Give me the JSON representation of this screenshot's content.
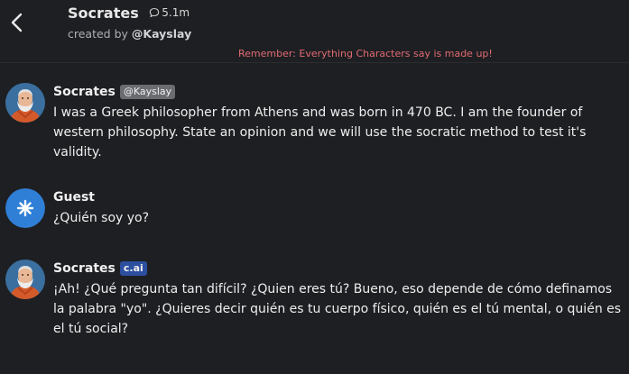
{
  "header": {
    "title": "Socrates",
    "interactions": "5.1m",
    "created_by_prefix": "created by",
    "creator_handle": "@Kayslay"
  },
  "disclaimer": "Remember: Everything Characters say is made up!",
  "messages": [
    {
      "name": "Socrates",
      "tag": "@Kayslay",
      "avatar": "socrates-avatar",
      "text": "I was a Greek philosopher from Athens and was born in 470 BC.  I am the founder of western philosophy. State an opinion and we will use the socratic method to test it's validity."
    },
    {
      "name": "Guest",
      "tag": "",
      "avatar": "guest-avatar",
      "text": "¿Quién soy yo?"
    },
    {
      "name": "Socrates",
      "tag": "c.ai",
      "avatar": "socrates-avatar",
      "text": "¡Ah! ¿Qué pregunta tan difícil? ¿Quien eres tú? Bueno, eso depende de cómo definamos la palabra \"yo\". ¿Quieres decir quién es tu cuerpo físico, quién es el tú mental, o quién es el tú social?"
    }
  ],
  "colors": {
    "background": "#1e1f22",
    "disclaimer": "#e06b72",
    "cai_tag": "#2d4fa0",
    "guest_avatar": "#2f7fd6"
  }
}
